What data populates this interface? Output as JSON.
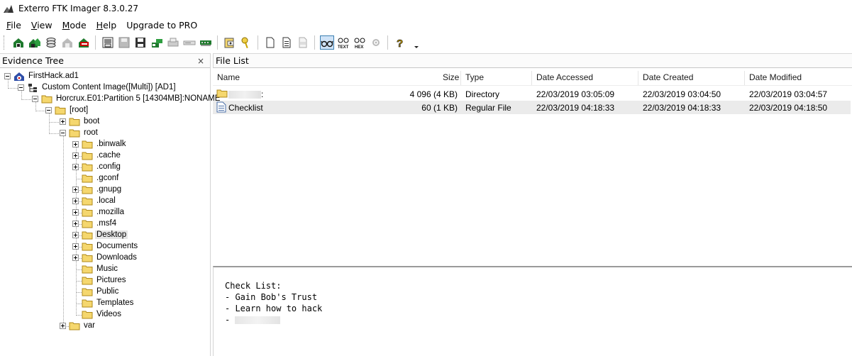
{
  "window": {
    "title": "Exterro FTK Imager 8.3.0.27"
  },
  "menu": {
    "items": [
      {
        "accel": "F",
        "rest": "ile"
      },
      {
        "accel": "V",
        "rest": "iew"
      },
      {
        "accel": "M",
        "rest": "ode"
      },
      {
        "accel": "H",
        "rest": "elp"
      },
      {
        "accel": "",
        "rest": "Upgrade to PRO"
      }
    ]
  },
  "evidence_tree": {
    "title": "Evidence Tree",
    "close_glyph": "×",
    "nodes": [
      {
        "label": "FirstHack.ad1"
      },
      {
        "label": "Custom Content Image([Multi]) [AD1]"
      },
      {
        "label": "Horcrux.E01:Partition 5 [14304MB]:NONAME"
      },
      {
        "label": "[root]"
      },
      {
        "label": "boot"
      },
      {
        "label": "root"
      },
      {
        "label": ".binwalk"
      },
      {
        "label": ".cache"
      },
      {
        "label": ".config"
      },
      {
        "label": ".gconf"
      },
      {
        "label": ".gnupg"
      },
      {
        "label": ".local"
      },
      {
        "label": ".mozilla"
      },
      {
        "label": ".msf4"
      },
      {
        "label": "Desktop"
      },
      {
        "label": "Documents"
      },
      {
        "label": "Downloads"
      },
      {
        "label": "Music"
      },
      {
        "label": "Pictures"
      },
      {
        "label": "Public"
      },
      {
        "label": "Templates"
      },
      {
        "label": "Videos"
      },
      {
        "label": "var"
      }
    ]
  },
  "file_list": {
    "title": "File List",
    "columns": [
      "Name",
      "Size",
      "Type",
      "Date Accessed",
      "Date Created",
      "Date Modified"
    ],
    "rows": [
      {
        "name_suffix": ":",
        "size": "4 096 (4 KB)",
        "type": "Directory",
        "accessed": "22/03/2019 03:05:09",
        "created": "22/03/2019 03:04:50",
        "modified": "22/03/2019 03:04:57"
      },
      {
        "name": "Checklist",
        "size": "60 (1 KB)",
        "type": "Regular File",
        "accessed": "22/03/2019 04:18:33",
        "created": "22/03/2019 04:18:33",
        "modified": "22/03/2019 04:18:50"
      }
    ]
  },
  "preview": {
    "lines": [
      "Check List:",
      "",
      "- Gain Bob's Trust",
      "- Learn how to hack",
      "- "
    ]
  },
  "colors": {
    "folder": "#f5d76e",
    "selection": "#e5e5e5",
    "toolbar_pressed": "#cfe3f7"
  }
}
